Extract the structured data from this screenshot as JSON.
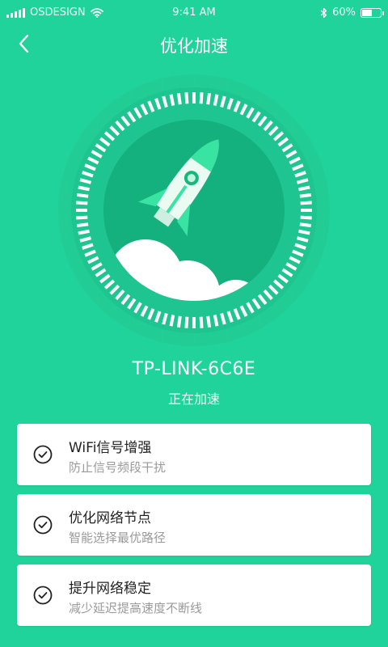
{
  "status_bar": {
    "carrier": "OSDESIGN",
    "time": "9:41 AM",
    "battery": "60%",
    "battery_level": 0.6,
    "icons": [
      "signal-icon",
      "wifi-icon",
      "bluetooth-icon",
      "battery-icon"
    ]
  },
  "nav": {
    "title": "优化加速",
    "back_icon": "chevron-left-icon"
  },
  "hero": {
    "illustration": "rocket-icon",
    "device_name": "TP-LINK-6C6E",
    "status": "正在加速"
  },
  "tasks": [
    {
      "title": "WiFi信号增强",
      "subtitle": "防止信号频段干扰",
      "icon": "check-circle-icon"
    },
    {
      "title": "优化网络节点",
      "subtitle": "智能选择最优路径",
      "icon": "check-circle-icon"
    },
    {
      "title": "提升网络稳定",
      "subtitle": "减少延迟提高速度不断线",
      "icon": "check-circle-icon"
    }
  ],
  "colors": {
    "background": "#1fd39a",
    "inner_circle": "#14b07d",
    "card": "#ffffff",
    "title_text": "#222222",
    "subtitle_text": "#9a9a9a"
  }
}
